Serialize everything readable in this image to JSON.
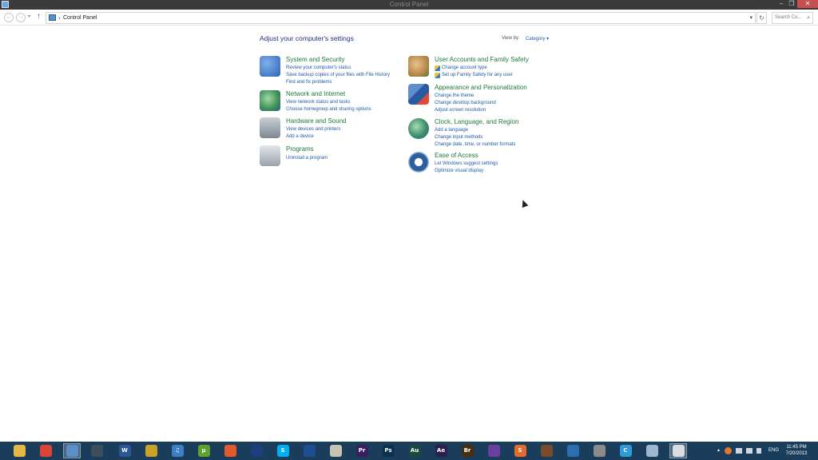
{
  "window": {
    "title": "Control Panel",
    "minimize": "–",
    "maximize": "❐",
    "close": "✕"
  },
  "nav": {
    "back": "←",
    "forward": "→",
    "recent": "▾",
    "up": "↑",
    "breadcrumb_sep": "›",
    "breadcrumb": "Control Panel",
    "address_dropdown": "▾",
    "refresh": "↻",
    "search_placeholder": "Search Co...",
    "search_icon": "⌕"
  },
  "content": {
    "heading": "Adjust your computer's settings",
    "view_by_label": "View by:",
    "view_by_value": "Category ▾"
  },
  "categories_left": [
    {
      "title": "System and Security",
      "icon": "shield-icon",
      "color": "#2f63b6",
      "links": [
        "Review your computer's status",
        "Save backup copies of your files with File History",
        "Find and fix problems"
      ]
    },
    {
      "title": "Network and Internet",
      "icon": "globe-network-icon",
      "color": "#3e8f55",
      "links": [
        "View network status and tasks",
        "Choose homegroup and sharing options"
      ]
    },
    {
      "title": "Hardware and Sound",
      "icon": "printer-speaker-icon",
      "color": "#7d8791",
      "links": [
        "View devices and printers",
        "Add a device"
      ]
    },
    {
      "title": "Programs",
      "icon": "programs-icon",
      "color": "#9aa3ab",
      "links": [
        "Uninstall a program"
      ]
    }
  ],
  "categories_right": [
    {
      "title": "User Accounts and Family Safety",
      "icon": "users-icon",
      "color": "#b8874a",
      "links": [
        "Change account type",
        "Set up Family Safety for any user"
      ]
    },
    {
      "title": "Appearance and Personalization",
      "icon": "display-brush-icon",
      "color": "#2a5aa0",
      "links": [
        "Change the theme",
        "Change desktop background",
        "Adjust screen resolution"
      ]
    },
    {
      "title": "Clock, Language, and Region",
      "icon": "clock-globe-icon",
      "color": "#3c8e6a",
      "links": [
        "Add a language",
        "Change input methods",
        "Change date, time, or number formats"
      ]
    },
    {
      "title": "Ease of Access",
      "icon": "ease-of-access-icon",
      "color": "#2d5f9c",
      "links": [
        "Let Windows suggest settings",
        "Optimize visual display"
      ]
    }
  ],
  "taskbar": {
    "apps": [
      {
        "name": "file-explorer",
        "icon": "folder-icon",
        "glyph": "",
        "color": "#e7b846"
      },
      {
        "name": "chrome",
        "icon": "chrome-icon",
        "glyph": "",
        "color": "#db4437"
      },
      {
        "name": "control-panel",
        "icon": "control-panel-icon",
        "glyph": "",
        "color": "#5b8fc9",
        "active": true
      },
      {
        "name": "steam",
        "icon": "steam-icon",
        "glyph": "",
        "color": "#3d4e5f"
      },
      {
        "name": "word",
        "icon": "word-icon",
        "glyph": "W",
        "color": "#2b5797"
      },
      {
        "name": "calculator",
        "icon": "grid-app-icon",
        "glyph": "",
        "color": "#c9a227"
      },
      {
        "name": "itunes",
        "icon": "itunes-icon",
        "glyph": "♫",
        "color": "#3c7fc6"
      },
      {
        "name": "utorrent",
        "icon": "utorrent-icon",
        "glyph": "µ",
        "color": "#5ba32b"
      },
      {
        "name": "app-orange",
        "icon": "orange-circle-icon",
        "glyph": "",
        "color": "#e05a2b"
      },
      {
        "name": "monitor-app",
        "icon": "monitor-icon",
        "glyph": "",
        "color": "#1c3e7a"
      },
      {
        "name": "skype",
        "icon": "skype-icon",
        "glyph": "S",
        "color": "#00aff0"
      },
      {
        "name": "sketch-app",
        "icon": "pen-icon",
        "glyph": "",
        "color": "#1d4e8f"
      },
      {
        "name": "compass-app",
        "icon": "compass-icon",
        "glyph": "",
        "color": "#c8c2b0"
      },
      {
        "name": "premiere",
        "icon": "premiere-icon",
        "glyph": "Pr",
        "color": "#3b1e5f"
      },
      {
        "name": "photoshop",
        "icon": "photoshop-icon",
        "glyph": "Ps",
        "color": "#0b3150"
      },
      {
        "name": "audition",
        "icon": "audition-icon",
        "glyph": "Au",
        "color": "#1a4a3e"
      },
      {
        "name": "after-effects",
        "icon": "after-effects-icon",
        "glyph": "Ae",
        "color": "#2c1f4f"
      },
      {
        "name": "bridge",
        "icon": "bridge-icon",
        "glyph": "Br",
        "color": "#4a2d0c"
      },
      {
        "name": "vs-app",
        "icon": "purple-app-icon",
        "glyph": "",
        "color": "#6a3fa0"
      },
      {
        "name": "sublime",
        "icon": "sublime-icon",
        "glyph": "S",
        "color": "#e36b2c"
      },
      {
        "name": "fl-studio",
        "icon": "equalizer-icon",
        "glyph": "",
        "color": "#7a4a2a"
      },
      {
        "name": "butterfly-app",
        "icon": "butterfly-icon",
        "glyph": "",
        "color": "#2c6fb0"
      },
      {
        "name": "gamepad-app",
        "icon": "gamepad-icon",
        "glyph": "",
        "color": "#8b8b8b"
      },
      {
        "name": "c-app",
        "icon": "c-logo-icon",
        "glyph": "C",
        "color": "#2e9bd6"
      },
      {
        "name": "notepad-app",
        "icon": "notepad-icon",
        "glyph": "",
        "color": "#9fb6cf"
      },
      {
        "name": "window-app",
        "icon": "window-icon",
        "glyph": "",
        "color": "#d8dde3",
        "active": true
      }
    ],
    "tray": {
      "up_arrow": "▴",
      "language": "ENG",
      "time": "11:45 PM",
      "date": "7/20/2013"
    }
  }
}
